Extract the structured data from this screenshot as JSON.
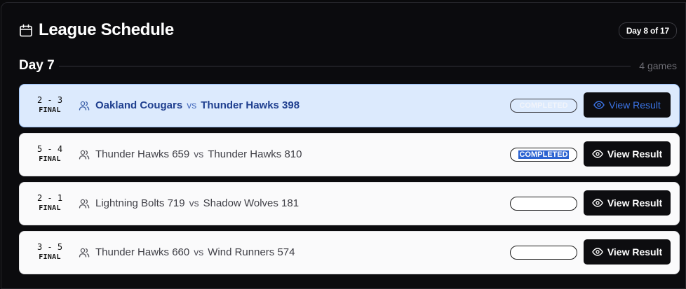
{
  "header": {
    "title": "League Schedule",
    "day_badge": "Day 8 of 17",
    "icon": "calendar-icon"
  },
  "day_section": {
    "label": "Day 7",
    "count": "4 games"
  },
  "games": [
    {
      "score": "2 - 3",
      "status_label": "FINAL",
      "home": "Oakland Cougars",
      "vs": "vs",
      "away": "Thunder Hawks 398",
      "badge": "COMPLETED",
      "button": "View Result",
      "selected": true
    },
    {
      "score": "5 - 4",
      "status_label": "FINAL",
      "home": "Thunder Hawks 659",
      "vs": "vs",
      "away": "Thunder Hawks 810",
      "badge": "COMPLETED",
      "button": "View Result",
      "selected": false
    },
    {
      "score": "2 - 1",
      "status_label": "FINAL",
      "home": "Lightning Bolts 719",
      "vs": "vs",
      "away": "Shadow Wolves 181",
      "badge": "",
      "button": "View Result",
      "selected": false
    },
    {
      "score": "3 - 5",
      "status_label": "FINAL",
      "home": "Thunder Hawks 660",
      "vs": "vs",
      "away": "Wind Runners 574",
      "badge": "",
      "button": "View Result",
      "selected": false
    }
  ],
  "colors": {
    "background": "#0b0b0e",
    "selected_row": "#dceafd",
    "accent": "#3b74e6",
    "text_highlight": "#2b63d1"
  }
}
